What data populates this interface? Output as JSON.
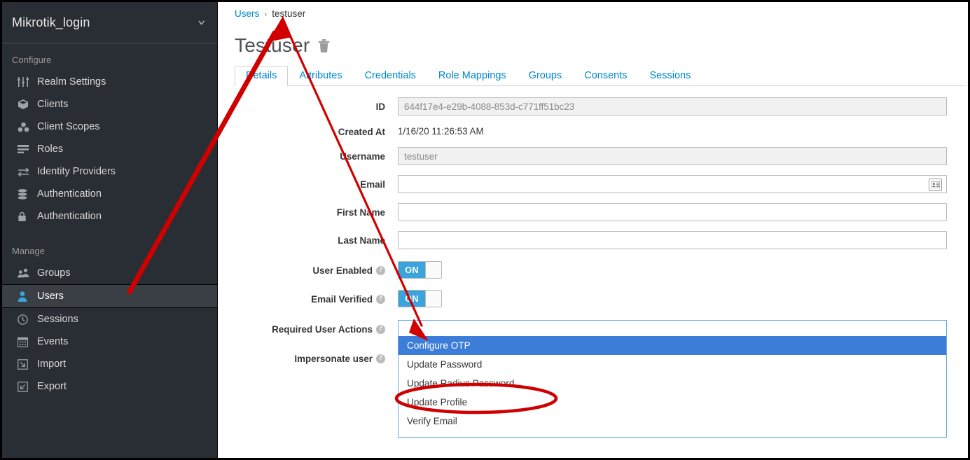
{
  "sidebar": {
    "realm": {
      "name": "Mikrotik_login",
      "chevron": "chevron-down-icon"
    },
    "sections": [
      {
        "title": "Configure",
        "items": [
          {
            "label": "Realm Settings",
            "icon": "sliders-icon"
          },
          {
            "label": "Clients",
            "icon": "cube-icon"
          },
          {
            "label": "Client Scopes",
            "icon": "cubes-icon"
          },
          {
            "label": "Roles",
            "icon": "list-icon"
          },
          {
            "label": "Identity Providers",
            "icon": "exchange-icon"
          },
          {
            "label": "Authentication",
            "icon": "lock-icon"
          }
        ]
      },
      {
        "title": "Manage",
        "items": [
          {
            "label": "Groups",
            "icon": "users-icon"
          },
          {
            "label": "Users",
            "icon": "user-icon",
            "active": true
          },
          {
            "label": "Sessions",
            "icon": "clock-icon"
          },
          {
            "label": "Events",
            "icon": "calendar-icon"
          },
          {
            "label": "Import",
            "icon": "import-icon"
          },
          {
            "label": "Export",
            "icon": "export-icon"
          }
        ]
      }
    ]
  },
  "breadcrumb": {
    "root": "Users",
    "separator": "›",
    "current": "testuser"
  },
  "page": {
    "title": "Testuser",
    "delete_icon": "trash-icon"
  },
  "tabs": [
    {
      "label": "Details",
      "active": true
    },
    {
      "label": "Attributes",
      "active": false
    },
    {
      "label": "Credentials",
      "active": false
    },
    {
      "label": "Role Mappings",
      "active": false
    },
    {
      "label": "Groups",
      "active": false
    },
    {
      "label": "Consents",
      "active": false
    },
    {
      "label": "Sessions",
      "active": false
    }
  ],
  "form": {
    "id": {
      "label": "ID",
      "value": "644f17e4-e29b-4088-853d-c771ff51bc23",
      "readonly": true
    },
    "created_at": {
      "label": "Created At",
      "value": "1/16/20 11:26:53 AM"
    },
    "username": {
      "label": "Username",
      "value": "testuser",
      "readonly": true
    },
    "email": {
      "label": "Email",
      "value": "",
      "icon": "contact-card-icon"
    },
    "first_name": {
      "label": "First Name",
      "value": ""
    },
    "last_name": {
      "label": "Last Name",
      "value": ""
    },
    "user_enabled": {
      "label": "User Enabled",
      "state": "ON",
      "help": "?"
    },
    "email_verified": {
      "label": "Email Verified",
      "state": "ON",
      "help": "?"
    },
    "required_user_actions": {
      "label": "Required User Actions",
      "help": "?",
      "options": [
        {
          "label": "Configure OTP",
          "selected": true
        },
        {
          "label": "Update Password",
          "selected": false
        },
        {
          "label": "Update Radius Password",
          "selected": false
        },
        {
          "label": "Update Profile",
          "selected": false
        },
        {
          "label": "Verify Email",
          "selected": false
        }
      ]
    },
    "impersonate_user": {
      "label": "Impersonate user",
      "help": "?"
    }
  },
  "annotations": {
    "color": "#d00000",
    "arrow_to_breadcrumb": "red-arrow-up",
    "arrow_to_dropdown": "red-arrow-down",
    "ellipse_highlight": "red-ellipse-update-radius-password"
  },
  "colors": {
    "sidebar_bg": "#292e34",
    "accent_blue": "#0088ce",
    "toggle_on": "#39a5dc",
    "option_selected": "#3b7dd8",
    "annotation_red": "#d00000"
  }
}
